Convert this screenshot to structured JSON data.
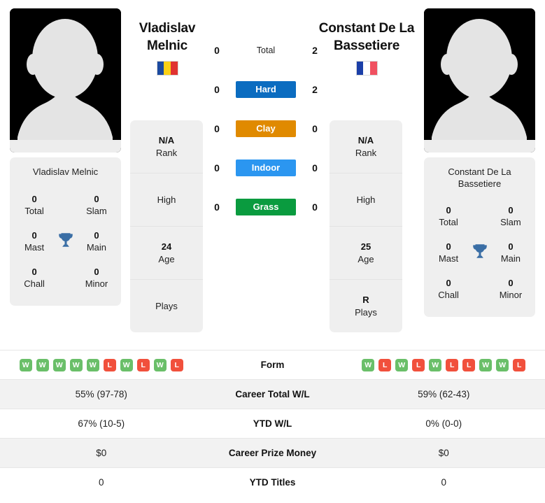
{
  "players": {
    "left": {
      "name": "Vladislav Melnic",
      "name_display": "Vladislav\nMelnic",
      "name_line1": "Vladislav",
      "name_line2": "Melnic",
      "country": "Romania",
      "flag_colors": [
        "#1b4aa0",
        "#fbd116",
        "#e03231"
      ],
      "card_name": "Vladislav Melnic",
      "titles": [
        {
          "value": "0",
          "label": "Total"
        },
        {
          "value": "0",
          "label": "Slam"
        },
        {
          "value": "0",
          "label": "Mast"
        },
        {
          "value": "0",
          "label": "Main"
        },
        {
          "value": "0",
          "label": "Chall"
        },
        {
          "value": "0",
          "label": "Minor"
        }
      ],
      "info": [
        {
          "value": "N/A",
          "label": "Rank"
        },
        {
          "value": "",
          "label": "High"
        },
        {
          "value": "24",
          "label": "Age"
        },
        {
          "value": "",
          "label": "Plays"
        }
      ],
      "form": [
        "W",
        "W",
        "W",
        "W",
        "W",
        "L",
        "W",
        "L",
        "W",
        "L"
      ]
    },
    "right": {
      "name": "Constant De La Bassetiere",
      "name_line1": "Constant De La",
      "name_line2": "Bassetiere",
      "country": "France",
      "flag_colors": [
        "#1b3fa8",
        "#ffffff",
        "#f05060"
      ],
      "card_name_line1": "Constant De La",
      "card_name_line2": "Bassetiere",
      "titles": [
        {
          "value": "0",
          "label": "Total"
        },
        {
          "value": "0",
          "label": "Slam"
        },
        {
          "value": "0",
          "label": "Mast"
        },
        {
          "value": "0",
          "label": "Main"
        },
        {
          "value": "0",
          "label": "Chall"
        },
        {
          "value": "0",
          "label": "Minor"
        }
      ],
      "info": [
        {
          "value": "N/A",
          "label": "Rank"
        },
        {
          "value": "",
          "label": "High"
        },
        {
          "value": "25",
          "label": "Age"
        },
        {
          "value": "R",
          "label": "Plays"
        }
      ],
      "form": [
        "W",
        "L",
        "W",
        "L",
        "W",
        "L",
        "L",
        "W",
        "W",
        "L"
      ]
    }
  },
  "head_to_head": [
    {
      "label": "Total",
      "left": "0",
      "right": "2",
      "color": "",
      "style": "plain"
    },
    {
      "label": "Hard",
      "left": "0",
      "right": "2",
      "color": "#0b6cc0",
      "style": "bar"
    },
    {
      "label": "Clay",
      "left": "0",
      "right": "0",
      "color": "#e08a00",
      "style": "bar"
    },
    {
      "label": "Indoor",
      "left": "0",
      "right": "0",
      "color": "#2b96f0",
      "style": "bar"
    },
    {
      "label": "Grass",
      "left": "0",
      "right": "0",
      "color": "#0a9b3f",
      "style": "bar"
    }
  ],
  "stats_rows": [
    {
      "label": "Form",
      "left": "",
      "right": "",
      "type": "form",
      "shaded": false
    },
    {
      "label": "Career Total W/L",
      "left": "55% (97-78)",
      "right": "59% (62-43)",
      "type": "text",
      "shaded": true
    },
    {
      "label": "YTD W/L",
      "left": "67% (10-5)",
      "right": "0% (0-0)",
      "type": "text",
      "shaded": false
    },
    {
      "label": "Career Prize Money",
      "left": "$0",
      "right": "$0",
      "type": "text",
      "shaded": true
    },
    {
      "label": "YTD Titles",
      "left": "0",
      "right": "0",
      "type": "text",
      "shaded": false
    }
  ],
  "colors": {
    "trophy": "#3a6ea5",
    "win_badge": "#6abf69",
    "loss_badge": "#f1503c",
    "card_bg": "#efefef",
    "row_shaded": "#f2f2f2"
  }
}
